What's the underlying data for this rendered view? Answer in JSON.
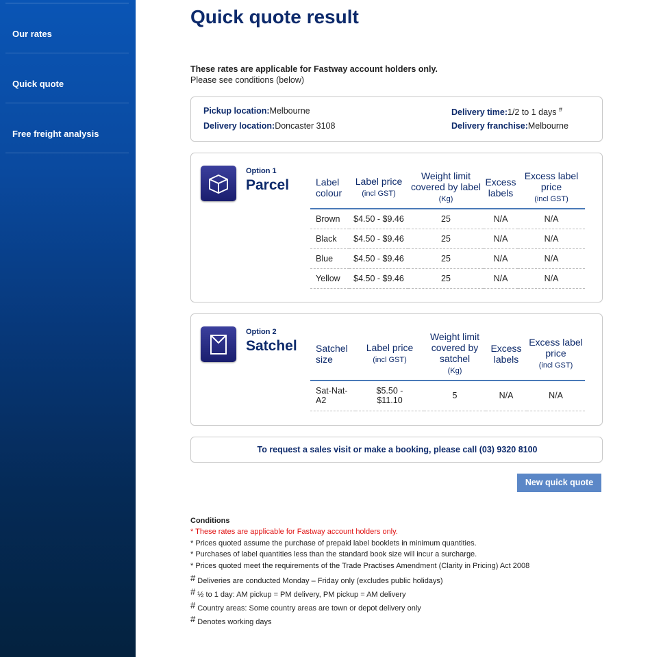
{
  "sidebar": {
    "items": [
      {
        "label": "Our rates"
      },
      {
        "label": "Quick quote"
      },
      {
        "label": "Free freight analysis"
      }
    ]
  },
  "page": {
    "title": "Quick quote result",
    "intro_bold": "These rates are applicable for Fastway account holders only.",
    "intro_text": "Please see conditions (below)"
  },
  "info": {
    "pickup_label": "Pickup location:",
    "pickup_value": "Melbourne",
    "delivery_label": "Delivery location:",
    "delivery_value": "Doncaster 3108",
    "time_label": "Delivery time:",
    "time_value": "1/2 to 1 days",
    "time_mark": "#",
    "franchise_label": "Delivery franchise:",
    "franchise_value": "Melbourne"
  },
  "option1": {
    "number": "Option 1",
    "name": "Parcel",
    "icon": "parcel-box-icon",
    "headers": {
      "c1": "Label colour",
      "c2": "Label price",
      "c2_sub": "(incl GST)",
      "c3": "Weight limit covered by label",
      "c3_sub": "(Kg)",
      "c4": "Excess labels",
      "c5": "Excess label price",
      "c5_sub": "(incl GST)"
    },
    "rows": [
      {
        "colour": "Brown",
        "price": "$4.50 - $9.46",
        "weight": "25",
        "excess": "N/A",
        "excess_price": "N/A"
      },
      {
        "colour": "Black",
        "price": "$4.50 - $9.46",
        "weight": "25",
        "excess": "N/A",
        "excess_price": "N/A"
      },
      {
        "colour": "Blue",
        "price": "$4.50 - $9.46",
        "weight": "25",
        "excess": "N/A",
        "excess_price": "N/A"
      },
      {
        "colour": "Yellow",
        "price": "$4.50 - $9.46",
        "weight": "25",
        "excess": "N/A",
        "excess_price": "N/A"
      }
    ]
  },
  "option2": {
    "number": "Option 2",
    "name": "Satchel",
    "icon": "satchel-envelope-icon",
    "headers": {
      "c1": "Satchel size",
      "c2": "Label price",
      "c2_sub": "(incl GST)",
      "c3": "Weight limit covered by satchel",
      "c3_sub": "(Kg)",
      "c4": "Excess labels",
      "c5": "Excess label price",
      "c5_sub": "(incl GST)"
    },
    "rows": [
      {
        "size_l1": "Sat-Nat-",
        "size_l2": "A2",
        "price_l1": "$5.50 -",
        "price_l2": "$11.10",
        "weight": "5",
        "excess": "N/A",
        "excess_price": "N/A"
      }
    ]
  },
  "call": {
    "text": "To request a sales visit or make a booking, please call (03) 9320 8100"
  },
  "buttons": {
    "new_quote": "New quick quote"
  },
  "conditions": {
    "title": "Conditions",
    "lines": [
      "* These rates are applicable for Fastway account holders only.",
      "* Prices quoted assume the purchase of prepaid label booklets in minimum quantities.",
      "* Purchases of label quantities less than the standard book size will incur a surcharge.",
      "* Prices quoted meet the requirements of the Trade Practises Amendment (Clarity in Pricing) Act 2008"
    ],
    "hash_mark": "#",
    "hash_lines": [
      "Deliveries are conducted Monday – Friday only (excludes public holidays)",
      "½ to 1 day: AM pickup = PM delivery, PM pickup = AM delivery",
      "Country areas: Some country areas are town or depot delivery only",
      "Denotes working days"
    ]
  },
  "colors": {
    "brand_navy": "#0d2a6b",
    "sidebar_blue": "#0a55b5",
    "button_blue": "#5b87c7",
    "warning_red": "#e01010"
  }
}
